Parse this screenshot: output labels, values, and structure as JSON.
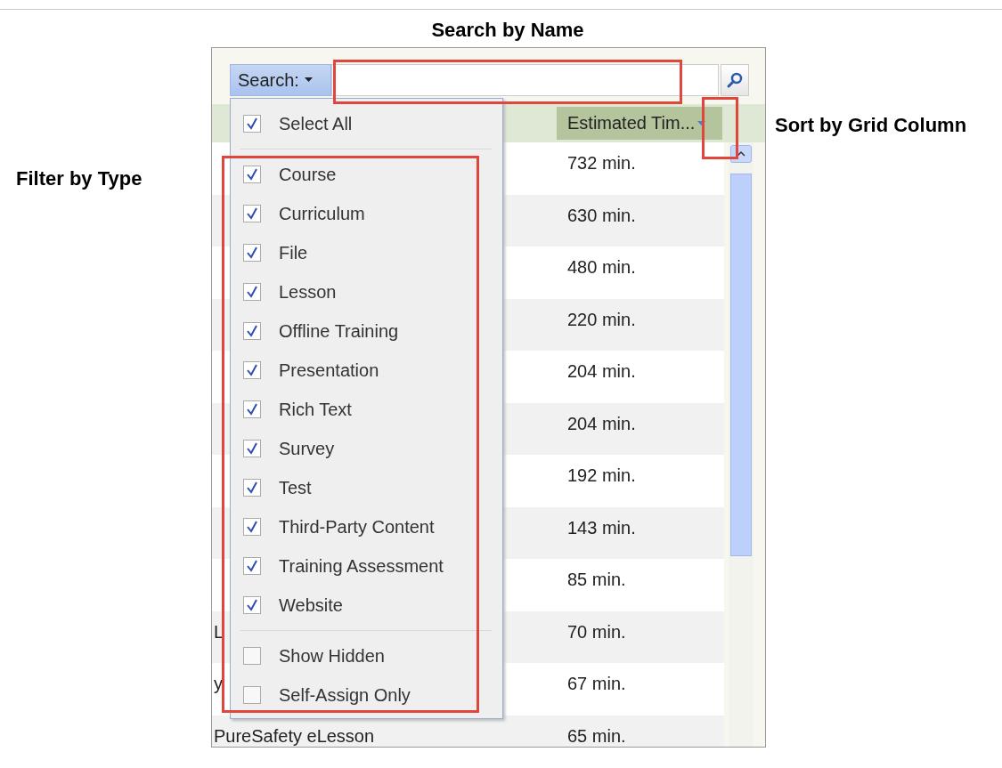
{
  "annotations": {
    "title": "Search by Name",
    "filter_label": "Filter by Type",
    "sort_label": "Sort by Grid Column"
  },
  "search": {
    "button": "Search:"
  },
  "grid": {
    "column": "Estimated Tim...",
    "rows": [
      {
        "time": "732 min."
      },
      {
        "time": "630 min."
      },
      {
        "time": "480 min."
      },
      {
        "time": "220 min."
      },
      {
        "time": "204 min."
      },
      {
        "time": "204 min."
      },
      {
        "time": "192 min."
      },
      {
        "time": "143 min."
      },
      {
        "time": "85 min."
      },
      {
        "name": "L",
        "time": "70 min."
      },
      {
        "name": "y",
        "time": "67 min."
      },
      {
        "name": "PureSafety eLesson",
        "time": "65 min."
      }
    ]
  },
  "filter_menu": {
    "groups": [
      [
        {
          "label": "Select All",
          "checked": true
        }
      ],
      [
        {
          "label": "Course",
          "checked": true
        },
        {
          "label": "Curriculum",
          "checked": true
        },
        {
          "label": "File",
          "checked": true
        },
        {
          "label": "Lesson",
          "checked": true
        },
        {
          "label": "Offline Training",
          "checked": true
        },
        {
          "label": "Presentation",
          "checked": true
        },
        {
          "label": "Rich Text",
          "checked": true
        },
        {
          "label": "Survey",
          "checked": true
        },
        {
          "label": "Test",
          "checked": true
        },
        {
          "label": "Third-Party Content",
          "checked": true
        },
        {
          "label": "Training Assessment",
          "checked": true
        },
        {
          "label": "Website",
          "checked": true
        }
      ],
      [
        {
          "label": "Show Hidden",
          "checked": false
        },
        {
          "label": "Self-Assign Only",
          "checked": false
        }
      ]
    ]
  }
}
